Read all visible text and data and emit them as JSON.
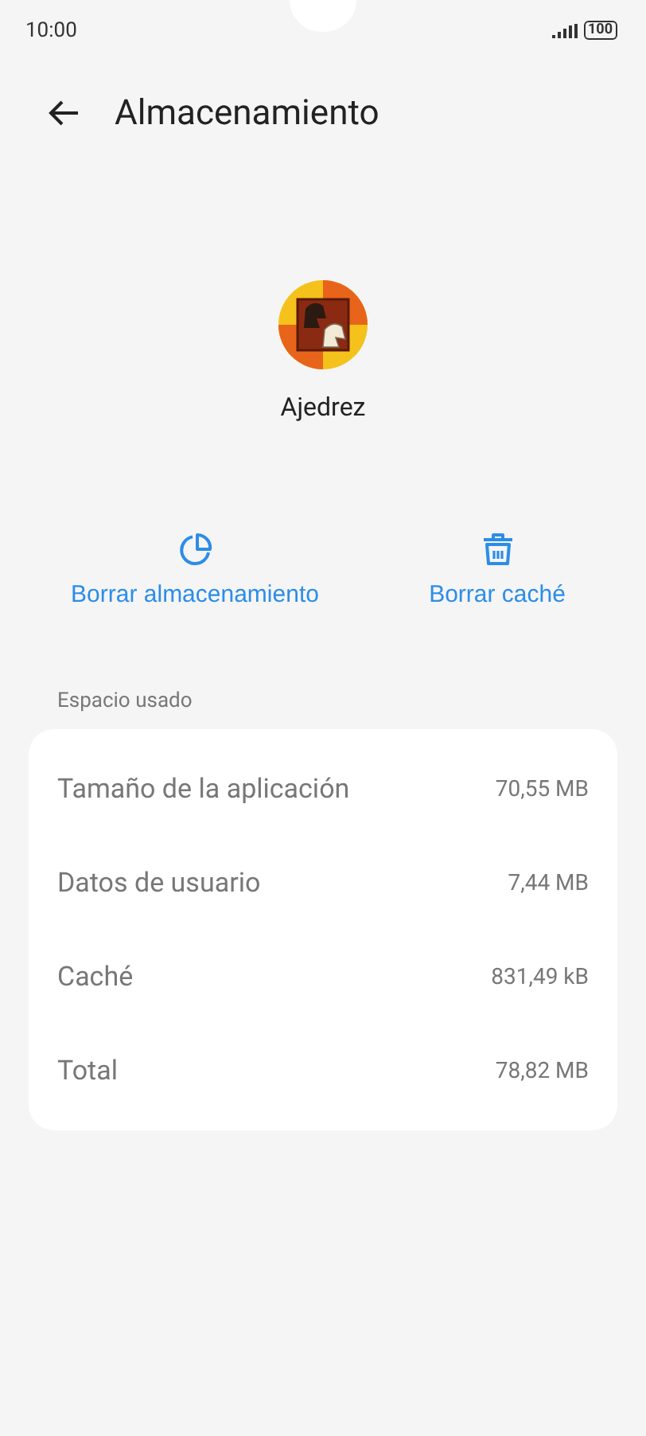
{
  "status_bar": {
    "time": "10:00",
    "battery": "100"
  },
  "header": {
    "title": "Almacenamiento"
  },
  "app": {
    "name": "Ajedrez"
  },
  "actions": [
    {
      "kind": "storage",
      "label": "Borrar almacenamiento"
    },
    {
      "kind": "cache",
      "label": "Borrar caché"
    }
  ],
  "section": {
    "title": "Espacio usado"
  },
  "rows": [
    {
      "label": "Tamaño de la aplicación",
      "value": "70,55 MB"
    },
    {
      "label": "Datos de usuario",
      "value": "7,44 MB"
    },
    {
      "label": "Caché",
      "value": "831,49 kB"
    },
    {
      "label": "Total",
      "value": "78,82 MB"
    }
  ]
}
